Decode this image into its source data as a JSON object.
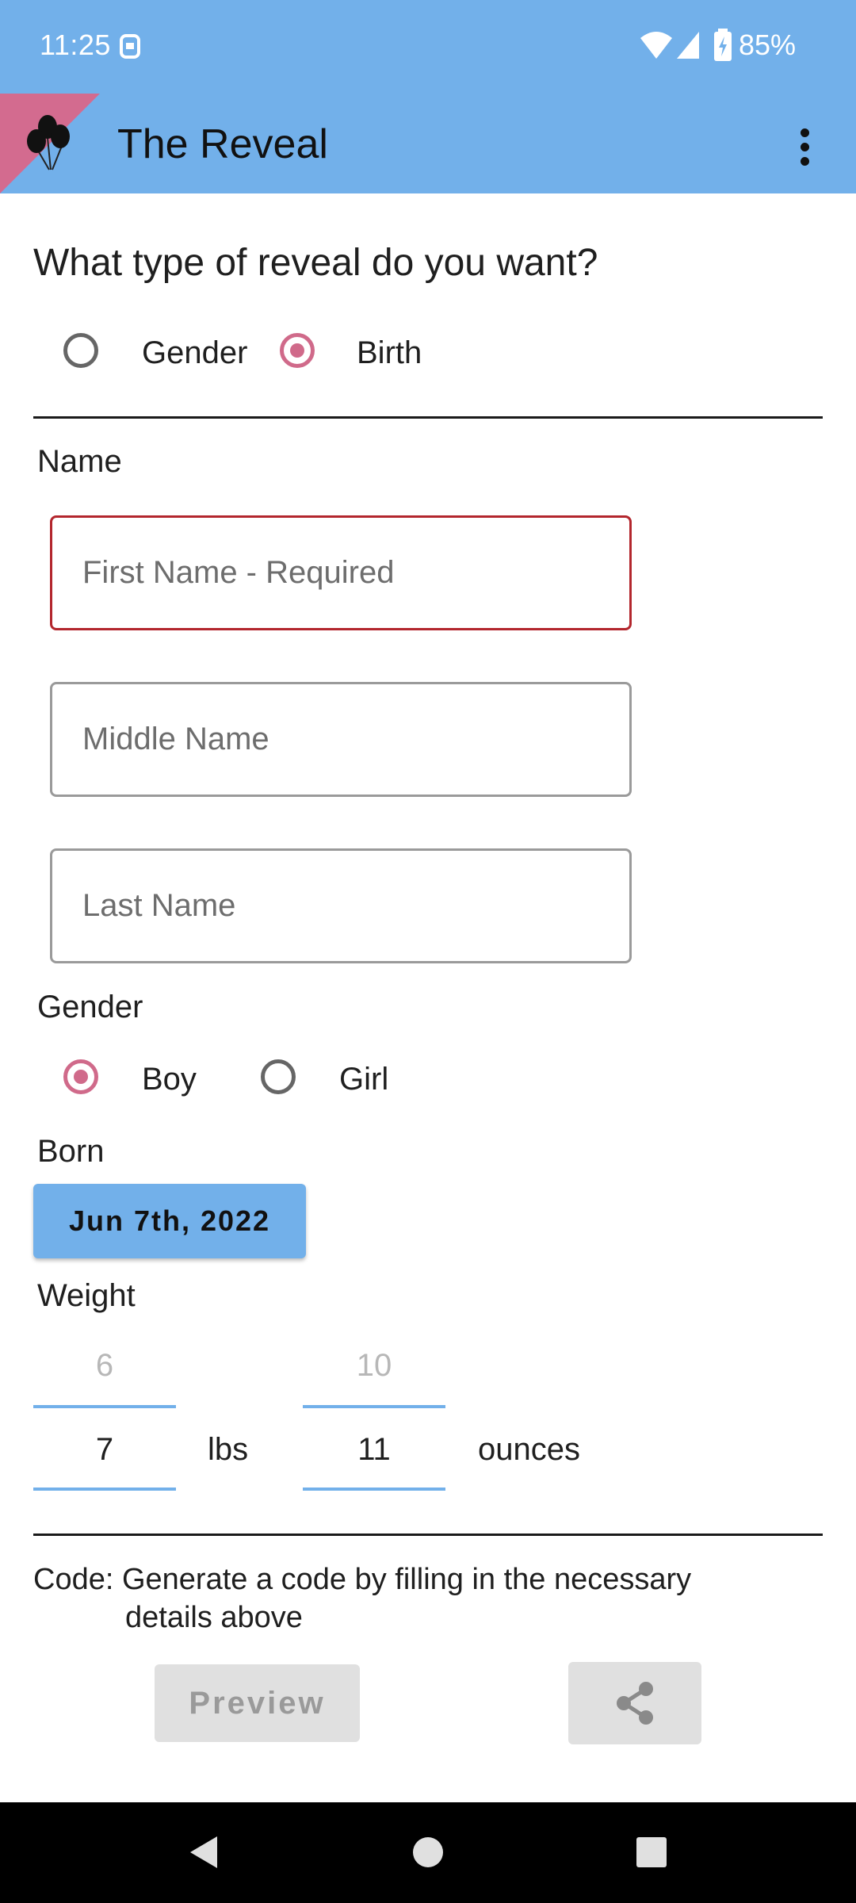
{
  "status_bar": {
    "time": "11:25",
    "battery_percent": "85%",
    "icons": [
      "sim-icon",
      "wifi-icon",
      "signal-icon",
      "battery-charging-icon"
    ]
  },
  "app_bar": {
    "title": "The Reveal",
    "logo_icon": "balloons-icon",
    "menu_icon": "more-vert-icon",
    "accent_color": "#72b0ea",
    "ribbon_color": "#d36b8f"
  },
  "reveal_type": {
    "question": "What type of reveal do you want?",
    "options": [
      {
        "label": "Gender",
        "selected": false
      },
      {
        "label": "Birth",
        "selected": true
      }
    ]
  },
  "name_section": {
    "label": "Name",
    "first_name": {
      "placeholder": "First Name - Required",
      "value": ""
    },
    "middle_name": {
      "placeholder": "Middle Name",
      "value": ""
    },
    "last_name": {
      "placeholder": "Last Name",
      "value": ""
    }
  },
  "gender_section": {
    "label": "Gender",
    "options": [
      {
        "label": "Boy",
        "selected": true
      },
      {
        "label": "Girl",
        "selected": false
      }
    ]
  },
  "born_section": {
    "label": "Born",
    "date": "Jun 7th, 2022"
  },
  "weight_section": {
    "label": "Weight",
    "lbs": {
      "previous": "6",
      "value": "7",
      "unit": "lbs"
    },
    "ounces": {
      "previous": "10",
      "value": "11",
      "unit": "ounces"
    }
  },
  "code_section": {
    "prefix": "Code:",
    "message_line1": "Generate a code by filling in the necessary",
    "message_line2": "details above"
  },
  "actions": {
    "preview_label": "Preview",
    "share_icon": "share-icon"
  },
  "nav_bar": {
    "icons": [
      "back-icon",
      "home-icon",
      "recents-icon"
    ]
  }
}
